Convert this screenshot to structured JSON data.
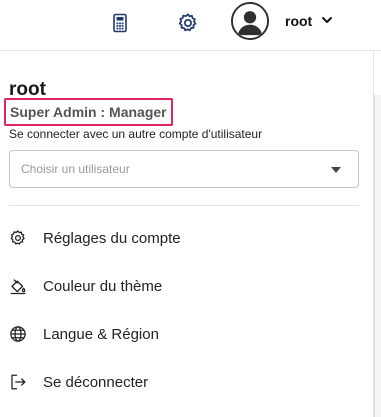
{
  "header": {
    "username": "root",
    "icons": [
      "calculator-icon",
      "gear-icon",
      "avatar-icon",
      "chevron-down-icon"
    ]
  },
  "panel": {
    "name": "root",
    "role": "Super Admin : Manager",
    "switch_label": "Se connecter avec un autre compte d'utilisateur",
    "select_placeholder": "Choisir un utilisateur",
    "highlight_color": "#e0245e",
    "menu": [
      {
        "label": "Réglages du compte",
        "icon": "settings-icon"
      },
      {
        "label": "Couleur du thème",
        "icon": "paint-bucket-icon"
      },
      {
        "label": "Langue & Région",
        "icon": "globe-icon"
      },
      {
        "label": "Se déconnecter",
        "icon": "logout-icon"
      }
    ]
  }
}
